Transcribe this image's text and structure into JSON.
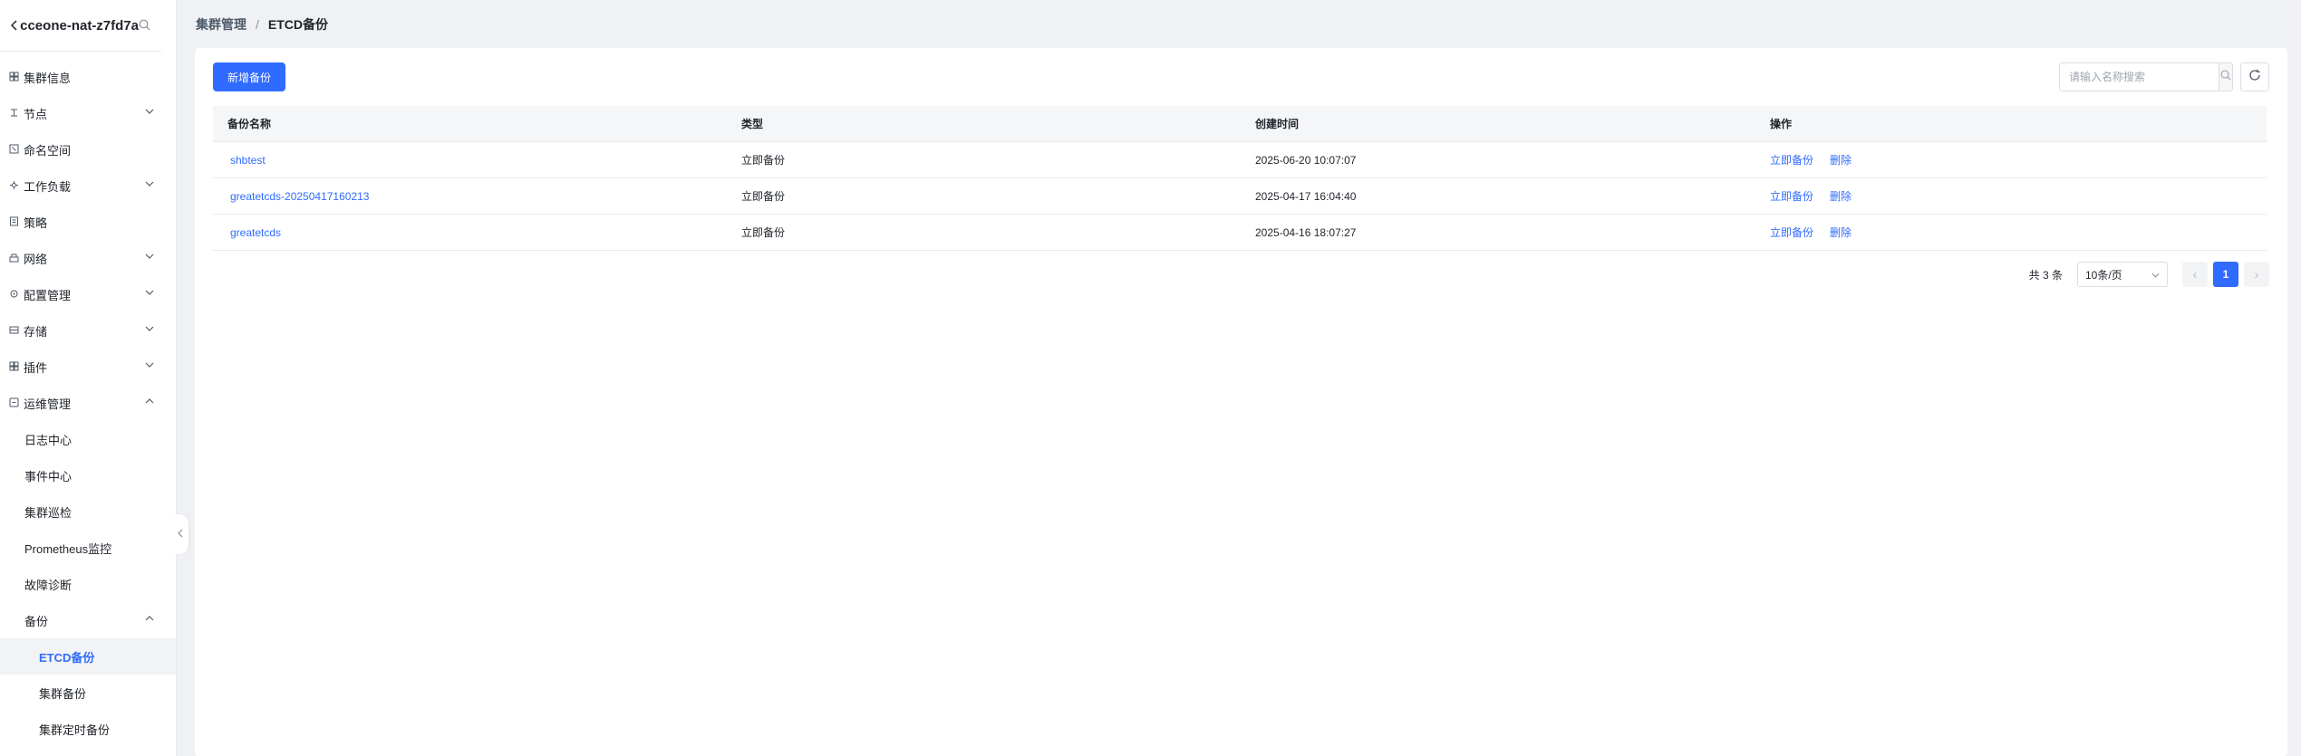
{
  "sidebar": {
    "cluster_name": "cceone-nat-z7fd7a",
    "items": [
      {
        "label": "集群信息",
        "icon": "cluster-info-icon"
      },
      {
        "label": "节点",
        "icon": "node-icon",
        "expand": "down"
      },
      {
        "label": "命名空间",
        "icon": "namespace-icon"
      },
      {
        "label": "工作负载",
        "icon": "workload-icon",
        "expand": "down"
      },
      {
        "label": "策略",
        "icon": "policy-icon"
      },
      {
        "label": "网络",
        "icon": "network-icon",
        "expand": "down"
      },
      {
        "label": "配置管理",
        "icon": "config-icon",
        "expand": "down"
      },
      {
        "label": "存储",
        "icon": "storage-icon",
        "expand": "down"
      },
      {
        "label": "插件",
        "icon": "plugin-icon",
        "expand": "down"
      },
      {
        "label": "运维管理",
        "icon": "ops-icon",
        "expand": "up"
      }
    ],
    "ops_children": [
      "日志中心",
      "事件中心",
      "集群巡检",
      "Prometheus监控",
      "故障诊断"
    ],
    "backup": {
      "label": "备份",
      "children": [
        "ETCD备份",
        "集群备份",
        "集群定时备份"
      ]
    }
  },
  "breadcrumb": {
    "parent": "集群管理",
    "separator": "/",
    "current": "ETCD备份"
  },
  "toolbar": {
    "add_label": "新增备份",
    "search_placeholder": "请输入名称搜索"
  },
  "table": {
    "headers": [
      "备份名称",
      "类型",
      "创建时间",
      "操作"
    ],
    "rows": [
      {
        "name": "shbtest",
        "type": "立即备份",
        "created": "2025-06-20 10:07:07"
      },
      {
        "name": "greatetcds-20250417160213",
        "type": "立即备份",
        "created": "2025-04-17 16:04:40"
      },
      {
        "name": "greatetcds",
        "type": "立即备份",
        "created": "2025-04-16 18:07:27"
      }
    ],
    "actions": {
      "backup": "立即备份",
      "delete": "删除"
    }
  },
  "pagination": {
    "total": "共 3 条",
    "page_size": "10条/页",
    "current_page": "1",
    "prev": "‹",
    "next": "›"
  },
  "colors": {
    "primary": "#2f6bff",
    "bg": "#f0f1f4"
  }
}
